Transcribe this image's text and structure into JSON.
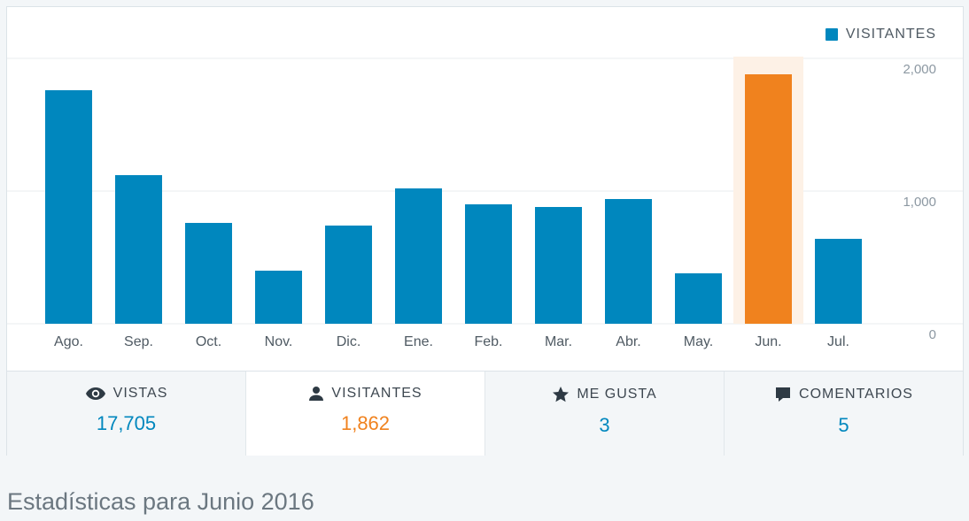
{
  "chart_data": {
    "type": "bar",
    "title": "",
    "xlabel": "",
    "ylabel": "",
    "categories": [
      "Ago.",
      "Sep.",
      "Oct.",
      "Nov.",
      "Dic.",
      "Ene.",
      "Feb.",
      "Mar.",
      "Abr.",
      "May.",
      "Jun.",
      "Jul."
    ],
    "series": [
      {
        "name": "VISITANTES",
        "values": [
          1760,
          1120,
          760,
          400,
          740,
          1020,
          900,
          880,
          940,
          380,
          1880,
          640
        ]
      }
    ],
    "highlight_index": 10,
    "ylim": [
      0,
      2000
    ],
    "yticks": [
      0,
      1000,
      2000
    ],
    "ytick_labels": [
      "0",
      "1,000",
      "2,000"
    ],
    "y_axis_side": "right",
    "grid": true,
    "legend_position": "top-right",
    "colors": {
      "bar": "#0087be",
      "highlight_bar": "#f0821e",
      "highlight_band": "#fdf1e6",
      "grid": "#e8ecef",
      "tick_label": "#4f5a63",
      "ytick_label": "#8c98a2"
    }
  },
  "legend": {
    "label": "VISITANTES"
  },
  "tabs": [
    {
      "label": "VISTAS",
      "value": "17,705",
      "icon": "eye-icon"
    },
    {
      "label": "VISITANTES",
      "value": "1,862",
      "icon": "person-icon",
      "active": true
    },
    {
      "label": "ME GUSTA",
      "value": "3",
      "icon": "star-icon"
    },
    {
      "label": "COMENTARIOS",
      "value": "5",
      "icon": "comment-icon"
    }
  ],
  "footer": {
    "title": "Estadísticas para Junio 2016"
  }
}
